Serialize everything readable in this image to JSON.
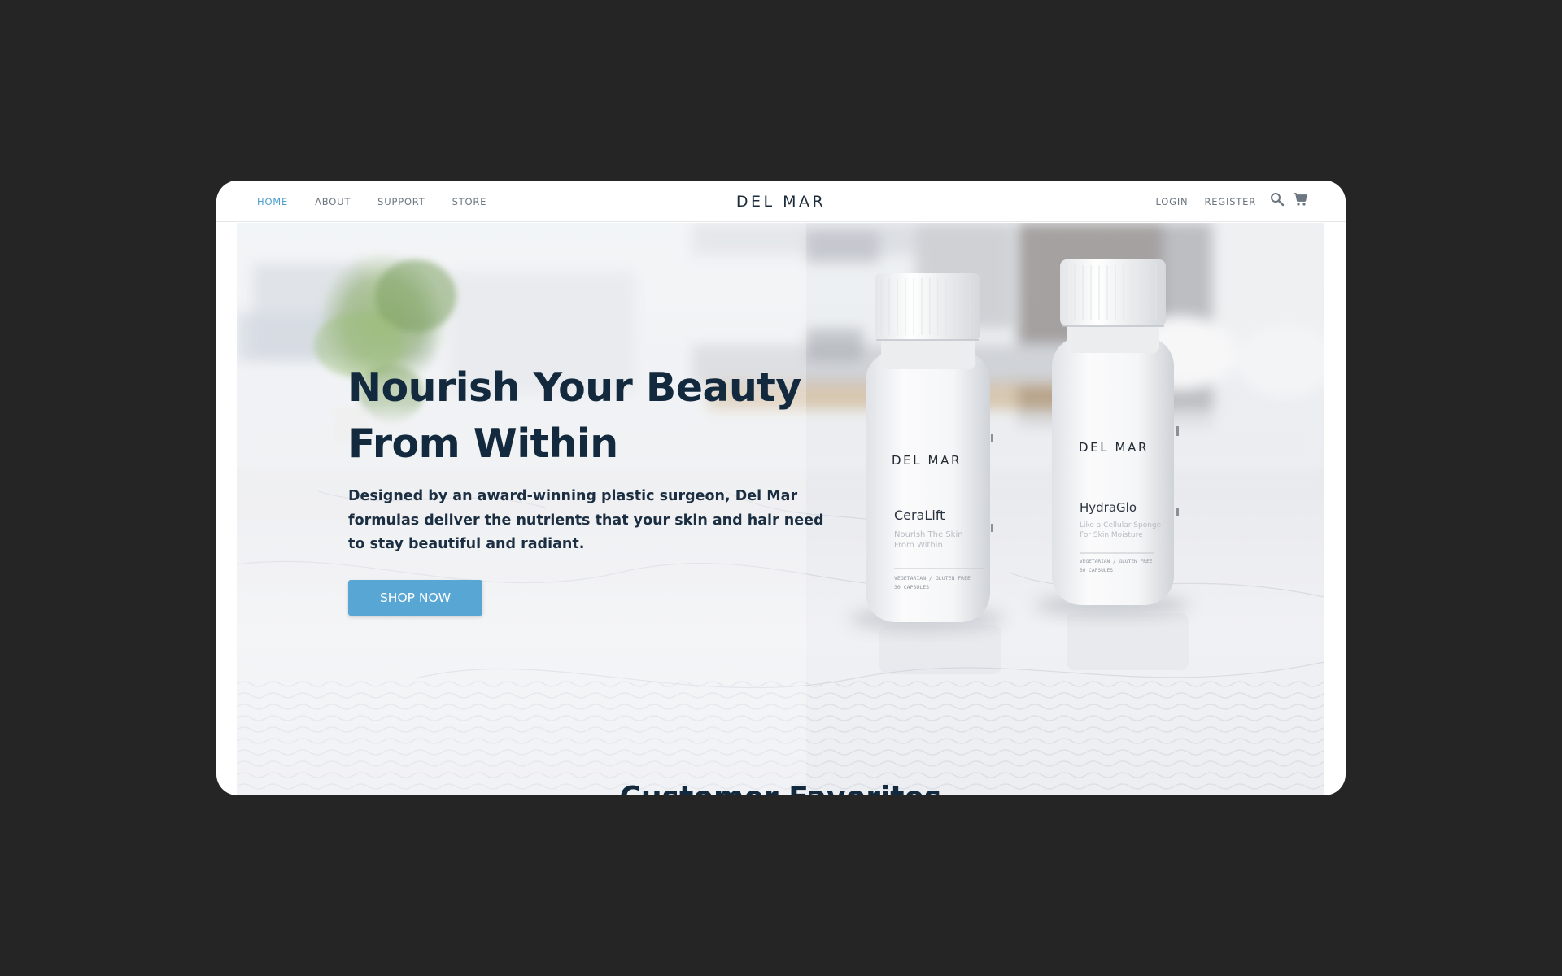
{
  "nav": {
    "left_links": [
      {
        "label": "HOME",
        "active": true
      },
      {
        "label": "ABOUT",
        "active": false
      },
      {
        "label": "SUPPORT",
        "active": false
      },
      {
        "label": "STORE",
        "active": false
      }
    ],
    "brand": "DEL MAR",
    "right_links": [
      {
        "label": "LOGIN"
      },
      {
        "label": "REGISTER"
      }
    ],
    "icons": [
      "search-icon",
      "cart-icon"
    ]
  },
  "hero": {
    "title_line1": "Nourish Your Beauty",
    "title_line2": "From Within",
    "subtitle": "Designed by an award-winning plastic surgeon, Del Mar formulas deliver the nutrients that your skin and hair need to stay beautiful and radiant.",
    "cta_label": "SHOP NOW"
  },
  "products": [
    {
      "brand": "DEL MAR",
      "name": "CeraLift",
      "tagline": "Nourish The Skin From Within",
      "meta": "VEGETARIAN / GLUTEN FREE",
      "count": "30 CAPSULES"
    },
    {
      "brand": "DEL MAR",
      "name": "HydraGlo",
      "tagline": "Like a Cellular Sponge For Skin Moisture",
      "meta": "VEGETARIAN / GLUTEN FREE",
      "count": "30 CAPSULES"
    }
  ],
  "section": {
    "title": "Customer Favorites"
  },
  "colors": {
    "accent": "#58a6d4",
    "nav_active": "#4f9fcc",
    "heading": "#13293d",
    "outer_bg": "#252525"
  }
}
